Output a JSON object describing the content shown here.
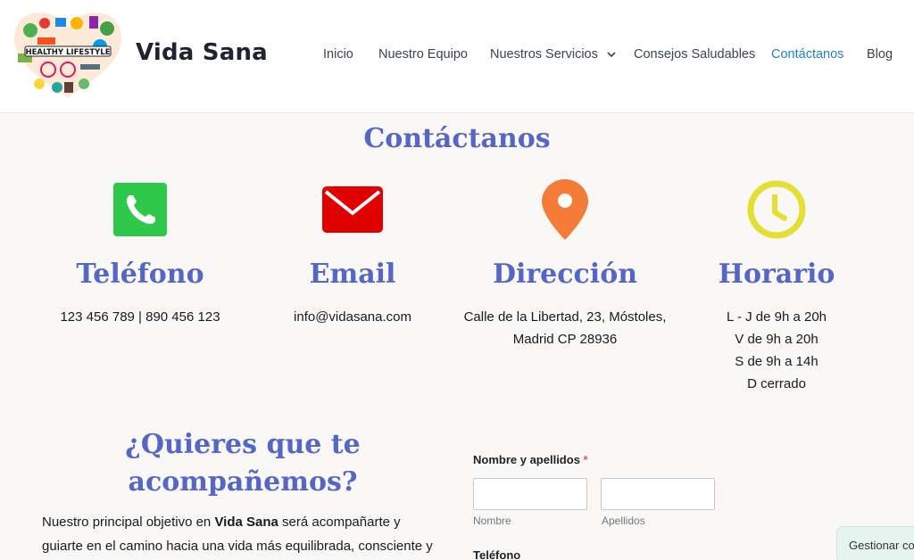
{
  "site": {
    "title": "Vida Sana",
    "logo_text": "HEALTHY LIFESTYLE"
  },
  "nav": [
    {
      "label": "Inicio"
    },
    {
      "label": "Nuestro Equipo"
    },
    {
      "label": "Nuestros Servicios"
    },
    {
      "label": "Consejos Saludables"
    },
    {
      "label": "Contáctanos"
    },
    {
      "label": "Blog"
    }
  ],
  "colors": {
    "accent": "#5566c4",
    "nav_active": "#1e7fd6",
    "phone_icon": "#2ec84a",
    "email_icon": "#e00000",
    "pin_icon": "#f47c38",
    "clock_icon": "#e3e033"
  },
  "page": {
    "heading": "Contáctanos",
    "info": [
      {
        "title": "Teléfono",
        "icon": "phone-icon",
        "lines": [
          "123 456 789 | 890 456 123"
        ]
      },
      {
        "title": "Email",
        "icon": "email-icon",
        "lines": [
          "info@vidasana.com"
        ]
      },
      {
        "title": "Dirección",
        "icon": "location-pin-icon",
        "lines": [
          "Calle de la Libertad, 23, Móstoles,",
          "Madrid CP 28936"
        ]
      },
      {
        "title": "Horario",
        "icon": "clock-icon",
        "lines": [
          "L - J de 9h a 20h",
          "V de 9h a 20h",
          "S de 9h a 14h",
          "D cerrado"
        ]
      }
    ],
    "cta": {
      "title_line1": "¿Quieres que te",
      "title_line2": "acompañemos?",
      "text_before": "Nuestro principal objetivo en ",
      "text_bold": "Vida Sana",
      "text_after": " será acompañarte y guiarte en el camino hacia una vida más equilibrada, consciente y saludable,"
    },
    "form": {
      "name_label": "Nombre y apellidos",
      "required_mark": "*",
      "first_sub": "Nombre",
      "last_sub": "Apellidos",
      "phone_label": "Teléfono"
    },
    "manage_button": "Gestionar co"
  }
}
